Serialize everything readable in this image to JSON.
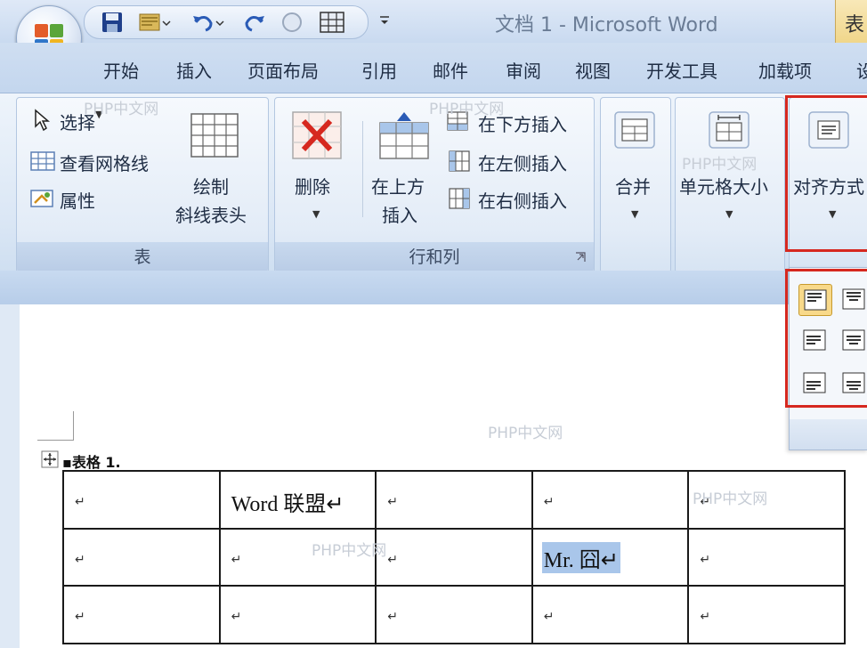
{
  "window": {
    "title": "文档 1 - Microsoft Word",
    "context_tab": "表"
  },
  "tabs": [
    "开始",
    "插入",
    "页面布局",
    "引用",
    "邮件",
    "审阅",
    "视图",
    "开发工具",
    "加载项",
    "设"
  ],
  "ribbon": {
    "table_group": {
      "label": "表",
      "select": "选择",
      "view_gridlines": "查看网格线",
      "properties": "属性",
      "draw_diagonal_line1": "绘制",
      "draw_diagonal_line2": "斜线表头"
    },
    "rows_cols_group": {
      "label": "行和列",
      "delete": "删除",
      "insert_above_line1": "在上方",
      "insert_above_line2": "插入",
      "insert_below": "在下方插入",
      "insert_left": "在左侧插入",
      "insert_right": "在右侧插入"
    },
    "merge": "合并",
    "cell_size": "单元格大小",
    "alignment": "对齐方式"
  },
  "document": {
    "caption": "表格 1.",
    "table": [
      [
        "↵",
        "Word 联盟↵",
        "↵",
        "↵",
        "↵"
      ],
      [
        "↵",
        "↵",
        "↵",
        "Mr. 囧↵",
        "↵"
      ],
      [
        "↵",
        "↵",
        "↵",
        "↵",
        "↵"
      ]
    ]
  },
  "watermarks": [
    "PHP中文网",
    "PHP中文网",
    "PHP中文网",
    "PHP中文网",
    "PHP中文网",
    "PHP中文网"
  ],
  "colors": {
    "highlight": "#a9c6ea",
    "red_box": "#d6281f"
  }
}
